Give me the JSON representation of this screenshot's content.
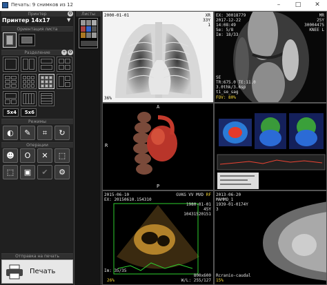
{
  "window": {
    "title": "Печать: 9 снимков из 12",
    "minimize": "–",
    "maximize": "□",
    "close": "✕"
  },
  "left": {
    "printer_section": "Принтер",
    "printer_name": "Принтер 14x17",
    "orientation_section": "Ориентация листа",
    "layout_section": "Разделение",
    "layout_labels": {
      "five_by_four": "5x4",
      "five_by_six": "5x6"
    },
    "modes_section": "Режимы",
    "operations_section": "Операции",
    "send_section": "Отправка на печать",
    "print_label": "Печать"
  },
  "thumbs_section": "Листы",
  "viewports": {
    "chest": {
      "date": "2000-01-01",
      "tag": "XR",
      "sex_age": "33Y",
      "pos": "1",
      "zoom": "36%"
    },
    "knee": {
      "ex": "EX: 30018779",
      "date": "2017-12-22",
      "time": "14:08:49",
      "se": "Se: 5/8",
      "im": "Im: 18/33",
      "mod": "MR",
      "sex_age": "25Y",
      "id": "30004475",
      "region": "KNEE L",
      "dir": "SE",
      "tr": "TR:675.0 TE:11.0",
      "seq": "3.0thk/3.6sp",
      "seq2": "t1_se_sag",
      "fov": "FOV: 80%"
    },
    "vr": {
      "top": "A",
      "left": "R",
      "bottom": "P"
    },
    "pet": {
      "scale": ""
    },
    "echo": {
      "date": "2015-06-10",
      "ex": "EX: 20150610.154310",
      "station": "GVKG VV MVD",
      "mark": "RF",
      "dob": "1980-01-01",
      "sex_age": "45Y",
      "study": "10431520151",
      "zoom": "26%",
      "im": "Im: 35/35",
      "size": "800x600",
      "wl": "W/L: 255/127"
    },
    "mammo": {
      "date": "2013-06-20",
      "mod": "MAMMO_1",
      "dob": "1939-01-01",
      "age": "74Y",
      "pos": "3",
      "view": "Rcranio-caudal",
      "zoom": "15%"
    }
  }
}
